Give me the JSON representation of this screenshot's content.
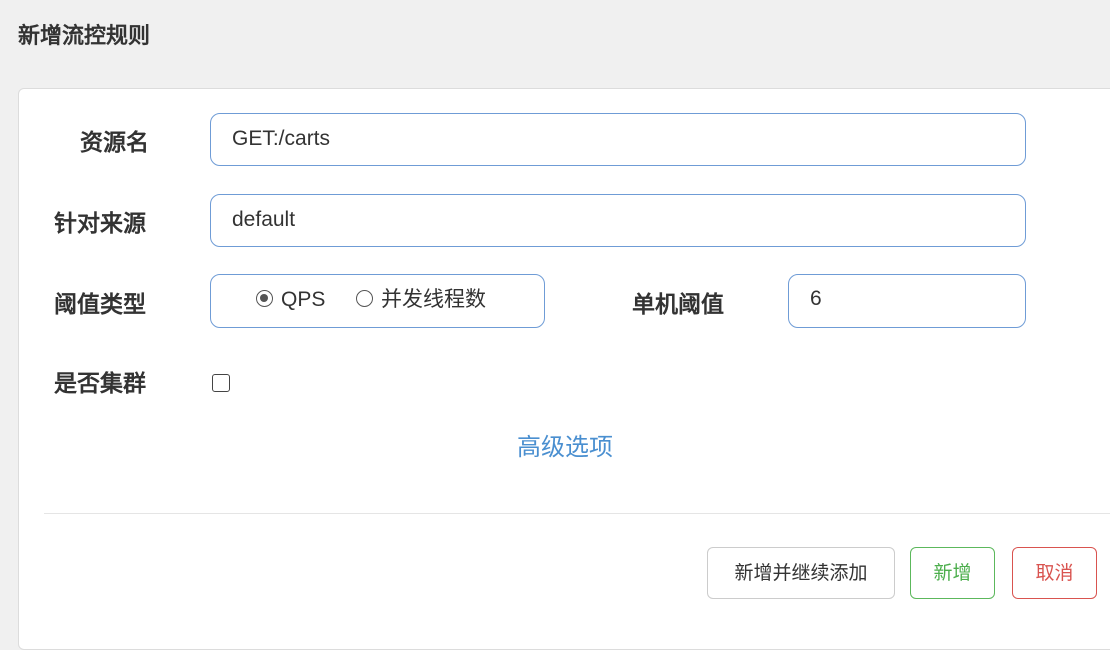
{
  "modal": {
    "title": "新增流控规则"
  },
  "form": {
    "resource_label": "资源名",
    "resource_value": "GET:/carts",
    "origin_label": "针对来源",
    "origin_value": "default",
    "threshold_type_label": "阈值类型",
    "threshold_type_options": [
      {
        "label": "QPS",
        "checked": true
      },
      {
        "label": "并发线程数",
        "checked": false
      }
    ],
    "single_threshold_label": "单机阈值",
    "single_threshold_value": "6",
    "cluster_label": "是否集群",
    "cluster_checked": false,
    "advanced_link": "高级选项"
  },
  "footer": {
    "continue_add_label": "新增并继续添加",
    "add_label": "新增",
    "cancel_label": "取消"
  },
  "colors": {
    "input_border": "#6f9cd6",
    "link": "#4a8fd0",
    "success": "#5cb85c",
    "danger": "#d9534f"
  }
}
